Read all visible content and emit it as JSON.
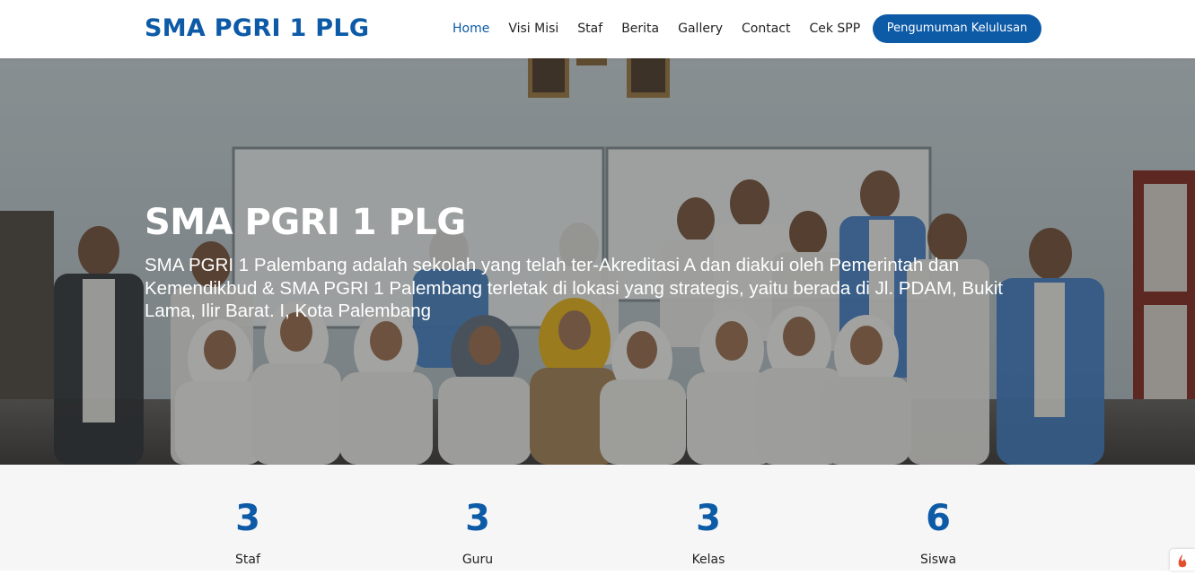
{
  "header": {
    "logo": "SMA PGRI 1 PLG",
    "nav": [
      "Home",
      "Visi Misi",
      "Staf",
      "Berita",
      "Gallery",
      "Contact",
      "Cek SPP"
    ],
    "active_nav": "Home",
    "cta": "Pengumuman Kelulusan"
  },
  "hero": {
    "title": "SMA PGRI 1 PLG",
    "description": "SMA PGRI 1 Palembang adalah sekolah yang telah ter-Akreditasi A dan diakui oleh Pemerintah dan Kemendikbud & SMA PGRI 1 Palembang terletak di lokasi yang strategis, yaitu berada di Jl. PDAM, Bukit Lama, Ilir Barat. I, Kota Palembang"
  },
  "stats": [
    {
      "value": "3",
      "label": "Staf"
    },
    {
      "value": "3",
      "label": "Guru"
    },
    {
      "value": "3",
      "label": "Kelas"
    },
    {
      "value": "6",
      "label": "Siswa"
    }
  ],
  "colors": {
    "brand": "#0d5aa7",
    "text": "#232323",
    "stats_bg": "#f6f6f6"
  },
  "icons": [
    "fire-icon"
  ]
}
